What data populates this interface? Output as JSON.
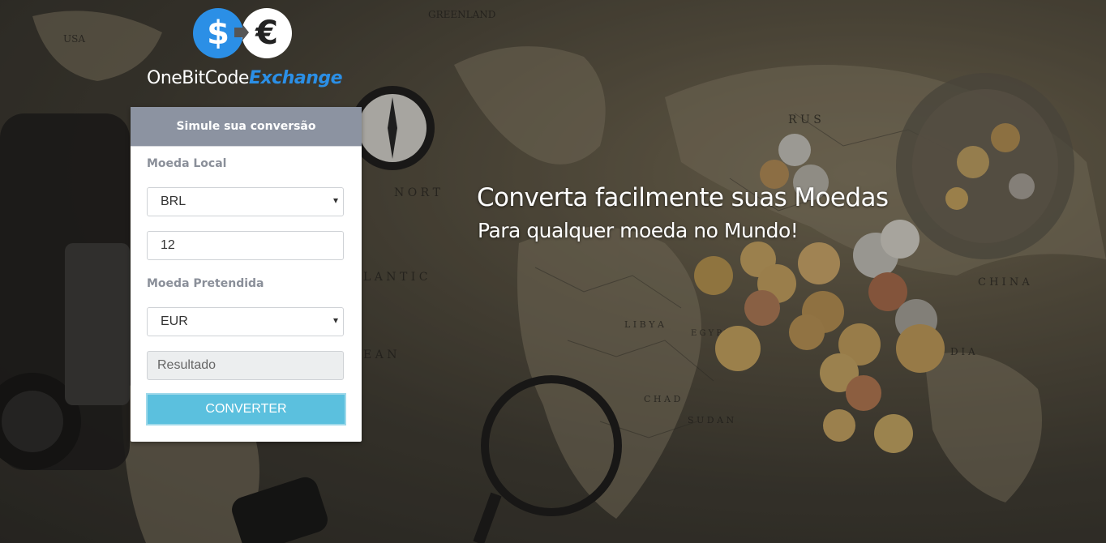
{
  "logo": {
    "dollar_symbol": "$",
    "euro_symbol": "€",
    "text_part1": "OneBitCode",
    "text_part2": "Exchange"
  },
  "card": {
    "header": "Simule sua conversão",
    "local_label": "Moeda Local",
    "local_currency": "BRL",
    "amount_value": "12",
    "target_label": "Moeda Pretendida",
    "target_currency": "EUR",
    "result_placeholder": "Resultado",
    "convert_button": "CONVERTER"
  },
  "hero": {
    "title": "Converta facilmente suas Moedas",
    "subtitle": "Para qualquer moeda no Mundo!"
  },
  "background_map_labels": [
    "USA",
    "GREENLAND",
    "R U S",
    "N O R T",
    "L A N T I C",
    "E A N",
    "L I B Y A",
    "E G Y P T",
    "C H A D",
    "S U D A N",
    "C H I N A",
    "D I A"
  ],
  "colors": {
    "brand_blue": "#2b8fe6",
    "card_header": "#8c93a1",
    "button": "#5bc0de",
    "label": "#8a8f99"
  },
  "icons": [
    "dollar-coin-icon",
    "euro-coin-icon",
    "exchange-arrow-icon",
    "select-caret-icon"
  ]
}
